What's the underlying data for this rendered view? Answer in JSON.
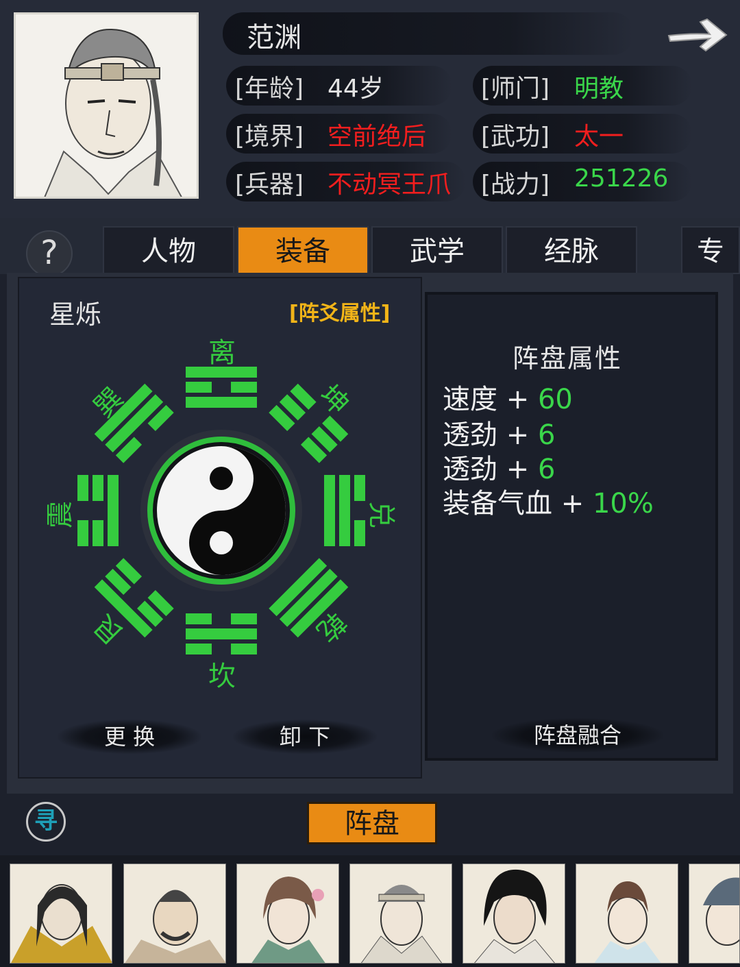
{
  "character": {
    "name": "范渊",
    "stats": [
      {
        "label": "[年龄]",
        "value": "44岁",
        "color": "white"
      },
      {
        "label": "[师门]",
        "value": "明教",
        "color": "green"
      },
      {
        "label": "[境界]",
        "value": "空前绝后",
        "color": "red"
      },
      {
        "label": "[武功]",
        "value": "太一",
        "color": "red"
      },
      {
        "label": "[兵器]",
        "value": "不动冥王爪",
        "color": "red"
      },
      {
        "label": "[战力]",
        "value": "251226",
        "color": "green"
      }
    ]
  },
  "tabs": {
    "help": "?",
    "items": [
      "人物",
      "装备",
      "武学",
      "经脉",
      "专"
    ],
    "active": "装备"
  },
  "formation": {
    "name": "星烁",
    "yao_link": "[阵爻属性]",
    "trigrams": [
      "离",
      "坤",
      "兑",
      "乾",
      "坎",
      "艮",
      "震",
      "巽"
    ],
    "trigram_color": "#35cc3f",
    "buttons": {
      "change": "更 换",
      "unequip": "卸 下"
    }
  },
  "attributes": {
    "title": "阵盘属性",
    "items": [
      {
        "name": "速度",
        "plus": "+",
        "value": "60"
      },
      {
        "name": "透劲",
        "plus": "+",
        "value": "6"
      },
      {
        "name": "透劲",
        "plus": "+",
        "value": "6"
      },
      {
        "name": "装备气血",
        "plus": "+",
        "value": "10%"
      }
    ],
    "fuse_button": "阵盘融合"
  },
  "bottom": {
    "seek_icon": "寻",
    "formation_tab": "阵盘"
  },
  "roster": {
    "count_visible": 7
  },
  "colors": {
    "accent_orange": "#e98b14",
    "green": "#3ad64a",
    "red": "#f21e1e",
    "gold": "#f2b418"
  }
}
